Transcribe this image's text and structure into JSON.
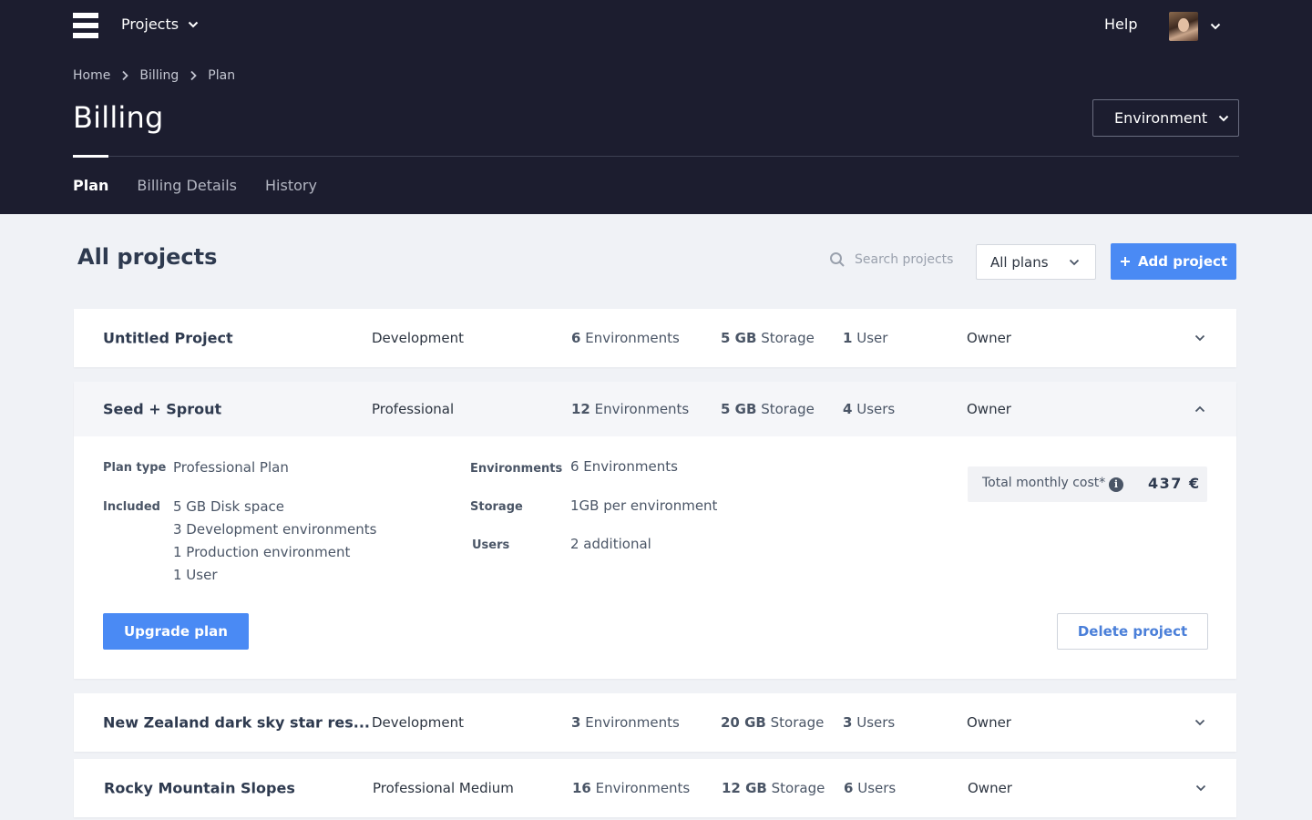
{
  "header": {
    "projects_menu_label": "Projects",
    "help_label": "Help",
    "breadcrumb": [
      "Home",
      "Billing",
      "Plan"
    ],
    "page_title": "Billing",
    "environment_select_label": "Environment",
    "tabs": [
      {
        "label": "Plan",
        "active": true
      },
      {
        "label": "Billing Details",
        "active": false
      },
      {
        "label": "History",
        "active": false
      }
    ]
  },
  "toolbar": {
    "section_title": "All projects",
    "search_placeholder": "Search projects",
    "plans_filter_value": "All plans",
    "add_project_label": "Add project"
  },
  "projects": [
    {
      "name": "Untitled Project",
      "plan": "Development",
      "environments": "6",
      "environments_unit": "Environments",
      "storage": "5 GB",
      "storage_unit": "Storage",
      "users": "1",
      "users_unit": "User",
      "role": "Owner",
      "expanded": false
    },
    {
      "name": "Seed + Sprout",
      "plan": "Professional",
      "environments": "12",
      "environments_unit": "Environments",
      "storage": "5 GB",
      "storage_unit": "Storage",
      "users": "4",
      "users_unit": "Users",
      "role": "Owner",
      "expanded": true
    },
    {
      "name": "New Zealand dark sky star res...",
      "plan": "Development",
      "environments": "3",
      "environments_unit": "Environments",
      "storage": "20 GB",
      "storage_unit": "Storage",
      "users": "3",
      "users_unit": "Users",
      "role": "Owner",
      "expanded": false
    },
    {
      "name": "Rocky Mountain Slopes",
      "plan": "Professional Medium",
      "environments": "16",
      "environments_unit": "Environments",
      "storage": "12 GB",
      "storage_unit": "Storage",
      "users": "6",
      "users_unit": "Users",
      "role": "Owner",
      "expanded": false
    }
  ],
  "expanded_details": {
    "plan_type_label": "Plan type",
    "plan_type_value": "Professional Plan",
    "included_label": "Included",
    "included_items": [
      "5 GB Disk space",
      "3 Development environments",
      "1 Production environment",
      "1 User"
    ],
    "environments_label": "Environments",
    "environments_value": "6 Environments",
    "storage_label": "Storage",
    "storage_value": "1GB per environment",
    "users_label": "Users",
    "users_value": "2 additional",
    "total_cost_label": "Total monthly cost*",
    "total_cost_value": "437 €",
    "upgrade_label": "Upgrade plan",
    "delete_label": "Delete project"
  },
  "colors": {
    "header_bg": "#1c1d2f",
    "primary": "#4a8af4",
    "page_bg": "#f0f2f6"
  }
}
